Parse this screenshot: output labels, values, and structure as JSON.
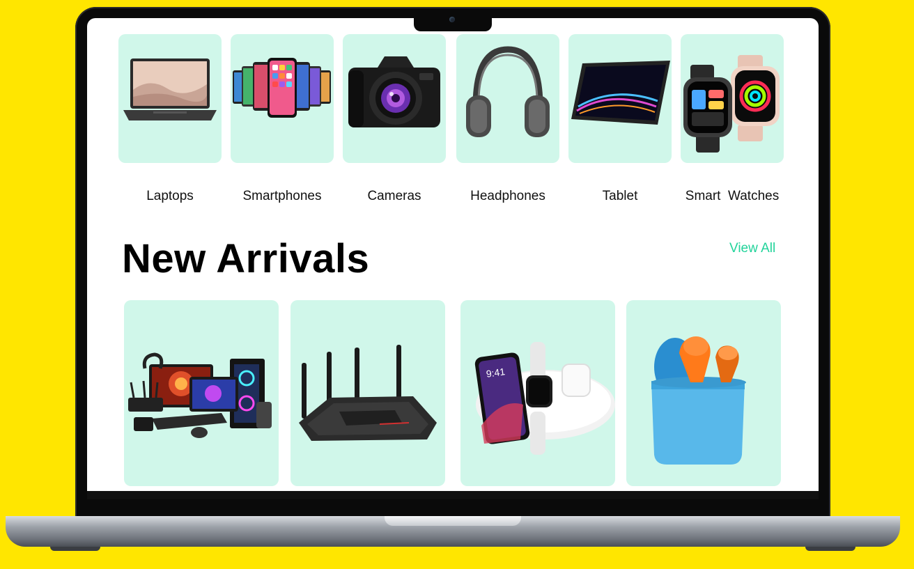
{
  "categories": [
    {
      "label": "Laptops",
      "icon": "laptop-icon"
    },
    {
      "label": "Smartphones",
      "icon": "smartphones-icon"
    },
    {
      "label": "Cameras",
      "icon": "camera-icon"
    },
    {
      "label": "Headphones",
      "icon": "headphones-icon"
    },
    {
      "label": "Tablet",
      "icon": "tablet-icon"
    },
    {
      "label": "Smart  Watches",
      "icon": "smartwatch-icon"
    }
  ],
  "new_arrivals": {
    "title": "New Arrivals",
    "view_all_label": "View All",
    "products": [
      {
        "icon": "gaming-pc-setup-icon"
      },
      {
        "icon": "wifi-router-icon"
      },
      {
        "icon": "wireless-charger-icon"
      },
      {
        "icon": "earbuds-case-icon"
      }
    ],
    "phone_time": "9:41"
  },
  "colors": {
    "background": "#FFE600",
    "card": "#D0F7EA",
    "accent": "#21D39A",
    "text": "#111111"
  }
}
